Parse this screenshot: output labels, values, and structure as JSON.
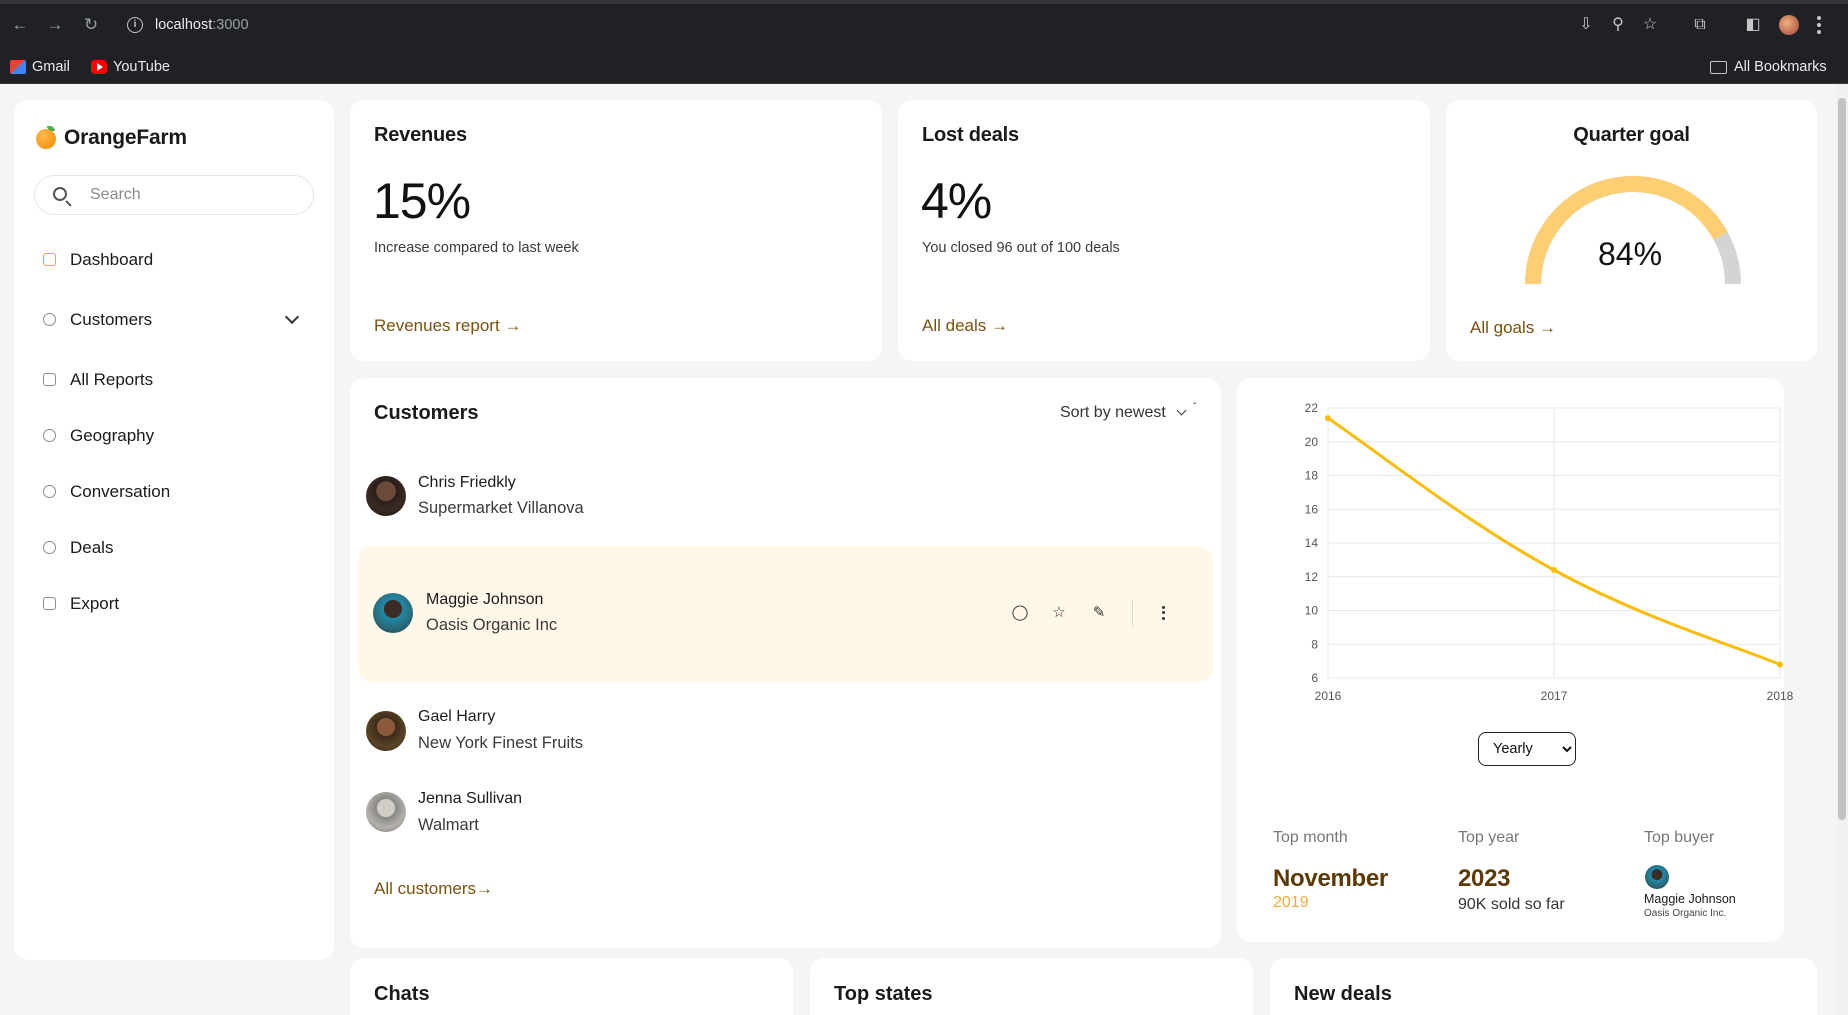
{
  "browser": {
    "url_host": "localhost",
    "url_port": ":3000",
    "bookmarks": [
      "Gmail",
      "YouTube"
    ],
    "all_bookmarks_label": "All Bookmarks"
  },
  "sidebar": {
    "brand": "OrangeFarm",
    "search_placeholder": "Search",
    "items": [
      {
        "label": "Dashboard",
        "icon": "dashboard-icon",
        "active": true
      },
      {
        "label": "Customers",
        "icon": "users-icon",
        "expandable": true
      },
      {
        "label": "All Reports",
        "icon": "report-icon"
      },
      {
        "label": "Geography",
        "icon": "globe-icon"
      },
      {
        "label": "Conversation",
        "icon": "chat-icon"
      },
      {
        "label": "Deals",
        "icon": "deals-icon"
      },
      {
        "label": "Export",
        "icon": "export-icon"
      }
    ]
  },
  "revenues": {
    "title": "Revenues",
    "value": "15%",
    "subtitle": "Increase compared to last week",
    "link": "Revenues report →"
  },
  "lost_deals": {
    "title": "Lost deals",
    "value": "4%",
    "subtitle": "You closed 96 out of 100 deals",
    "link": "All deals →"
  },
  "quarter_goal": {
    "title": "Quarter goal",
    "value_label": "84%",
    "progress": 0.84,
    "link": "All goals →",
    "colors": {
      "fill": "#fdcf72",
      "track": "#d4d4d4"
    }
  },
  "customers": {
    "title": "Customers",
    "sort_label": "Sort by newest",
    "sort_mark": "ˇ",
    "rows": [
      {
        "name": "Chris Friedkly",
        "company": "Supermarket Villanova"
      },
      {
        "name": "Maggie Johnson",
        "company": "Oasis Organic Inc"
      },
      {
        "name": "Gael Harry",
        "company": "New York Finest Fruits"
      },
      {
        "name": "Jenna Sullivan",
        "company": "Walmart"
      }
    ],
    "row_actions": [
      "chat-bubble-icon",
      "star-icon",
      "pencil-icon",
      "more-vertical-icon"
    ],
    "link": "All customers→"
  },
  "chart_data": {
    "type": "line",
    "x": [
      2016,
      2017,
      2018
    ],
    "series": [
      {
        "values": [
          21.4,
          12.4,
          6.8
        ]
      }
    ],
    "x_tick_labels": [
      "2016",
      "2017",
      "2018"
    ],
    "y_tick_labels": [
      "6",
      "8",
      "10",
      "12",
      "14",
      "16",
      "18",
      "20",
      "22"
    ],
    "ylim": [
      6,
      22
    ],
    "grid": true,
    "color": "#fbbc05"
  },
  "period_select": {
    "selected": "Yearly"
  },
  "top_stats": {
    "top_month": {
      "label": "Top month",
      "value": "November",
      "sub": "2019"
    },
    "top_year": {
      "label": "Top year",
      "value": "2023",
      "sub": "90K sold so far"
    },
    "top_buyer": {
      "label": "Top buyer",
      "name": "Maggie Johnson",
      "company": "Oasis Organic Inc."
    }
  },
  "bottom_cards": {
    "chats": "Chats",
    "top_states": "Top states",
    "new_deals": "New deals"
  }
}
